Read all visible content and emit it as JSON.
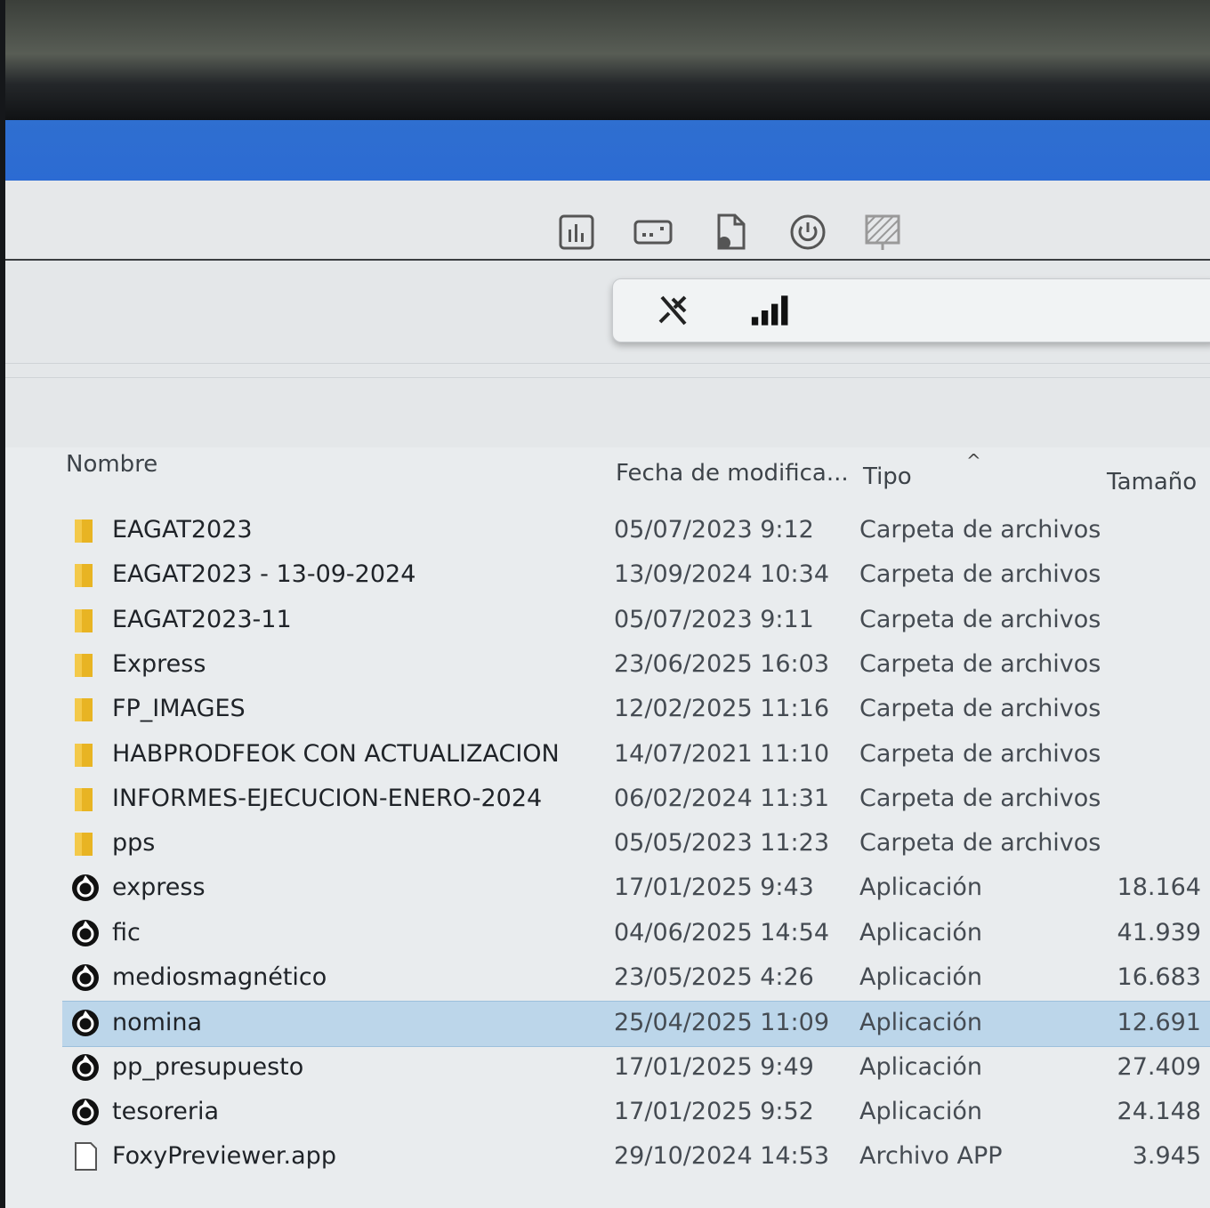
{
  "toolbar": {
    "buttons": [
      {
        "icon": "bar-chart-icon"
      },
      {
        "icon": "keyboard-icon"
      },
      {
        "icon": "file-icon"
      },
      {
        "icon": "power-icon"
      },
      {
        "icon": "grid-icon"
      }
    ],
    "popup_buttons": [
      {
        "icon": "unpin-icon"
      },
      {
        "icon": "signal-bars-icon"
      }
    ]
  },
  "columns": {
    "name": "Nombre",
    "date": "Fecha de modifica...",
    "type": "Tipo",
    "size": "Tamaño"
  },
  "files": [
    {
      "kind": "folder",
      "name": "EAGAT2023",
      "date": "05/07/2023 9:12",
      "type": "Carpeta de archivos",
      "size": ""
    },
    {
      "kind": "folder",
      "name": "EAGAT2023 - 13-09-2024",
      "date": "13/09/2024 10:34",
      "type": "Carpeta de archivos",
      "size": ""
    },
    {
      "kind": "folder",
      "name": "EAGAT2023-11",
      "date": "05/07/2023 9:11",
      "type": "Carpeta de archivos",
      "size": ""
    },
    {
      "kind": "folder",
      "name": "Express",
      "date": "23/06/2025 16:03",
      "type": "Carpeta de archivos",
      "size": ""
    },
    {
      "kind": "folder",
      "name": "FP_IMAGES",
      "date": "12/02/2025 11:16",
      "type": "Carpeta de archivos",
      "size": ""
    },
    {
      "kind": "folder",
      "name": "HABPRODFEOK CON ACTUALIZACION",
      "date": "14/07/2021 11:10",
      "type": "Carpeta de archivos",
      "size": ""
    },
    {
      "kind": "folder",
      "name": "INFORMES-EJECUCION-ENERO-2024",
      "date": "06/02/2024 11:31",
      "type": "Carpeta de archivos",
      "size": ""
    },
    {
      "kind": "folder",
      "name": "pps",
      "date": "05/05/2023 11:23",
      "type": "Carpeta de archivos",
      "size": ""
    },
    {
      "kind": "app",
      "name": "express",
      "date": "17/01/2025 9:43",
      "type": "Aplicación",
      "size": "18.164"
    },
    {
      "kind": "app",
      "name": "fic",
      "date": "04/06/2025 14:54",
      "type": "Aplicación",
      "size": "41.939"
    },
    {
      "kind": "app",
      "name": "mediosmagnético",
      "date": "23/05/2025 4:26",
      "type": "Aplicación",
      "size": "16.683"
    },
    {
      "kind": "app",
      "name": "nomina",
      "date": "25/04/2025 11:09",
      "type": "Aplicación",
      "size": "12.691",
      "selected": true
    },
    {
      "kind": "app",
      "name": "pp_presupuesto",
      "date": "17/01/2025 9:49",
      "type": "Aplicación",
      "size": "27.409"
    },
    {
      "kind": "app",
      "name": "tesoreria",
      "date": "17/01/2025 9:52",
      "type": "Aplicación",
      "size": "24.148"
    },
    {
      "kind": "file",
      "name": "FoxyPreviewer.app",
      "date": "29/10/2024 14:53",
      "type": "Archivo APP",
      "size": "3.945"
    }
  ],
  "colors": {
    "titlebar": "#2c6bd3",
    "selection": "#bcd6ea",
    "folder": "#e8b423"
  }
}
